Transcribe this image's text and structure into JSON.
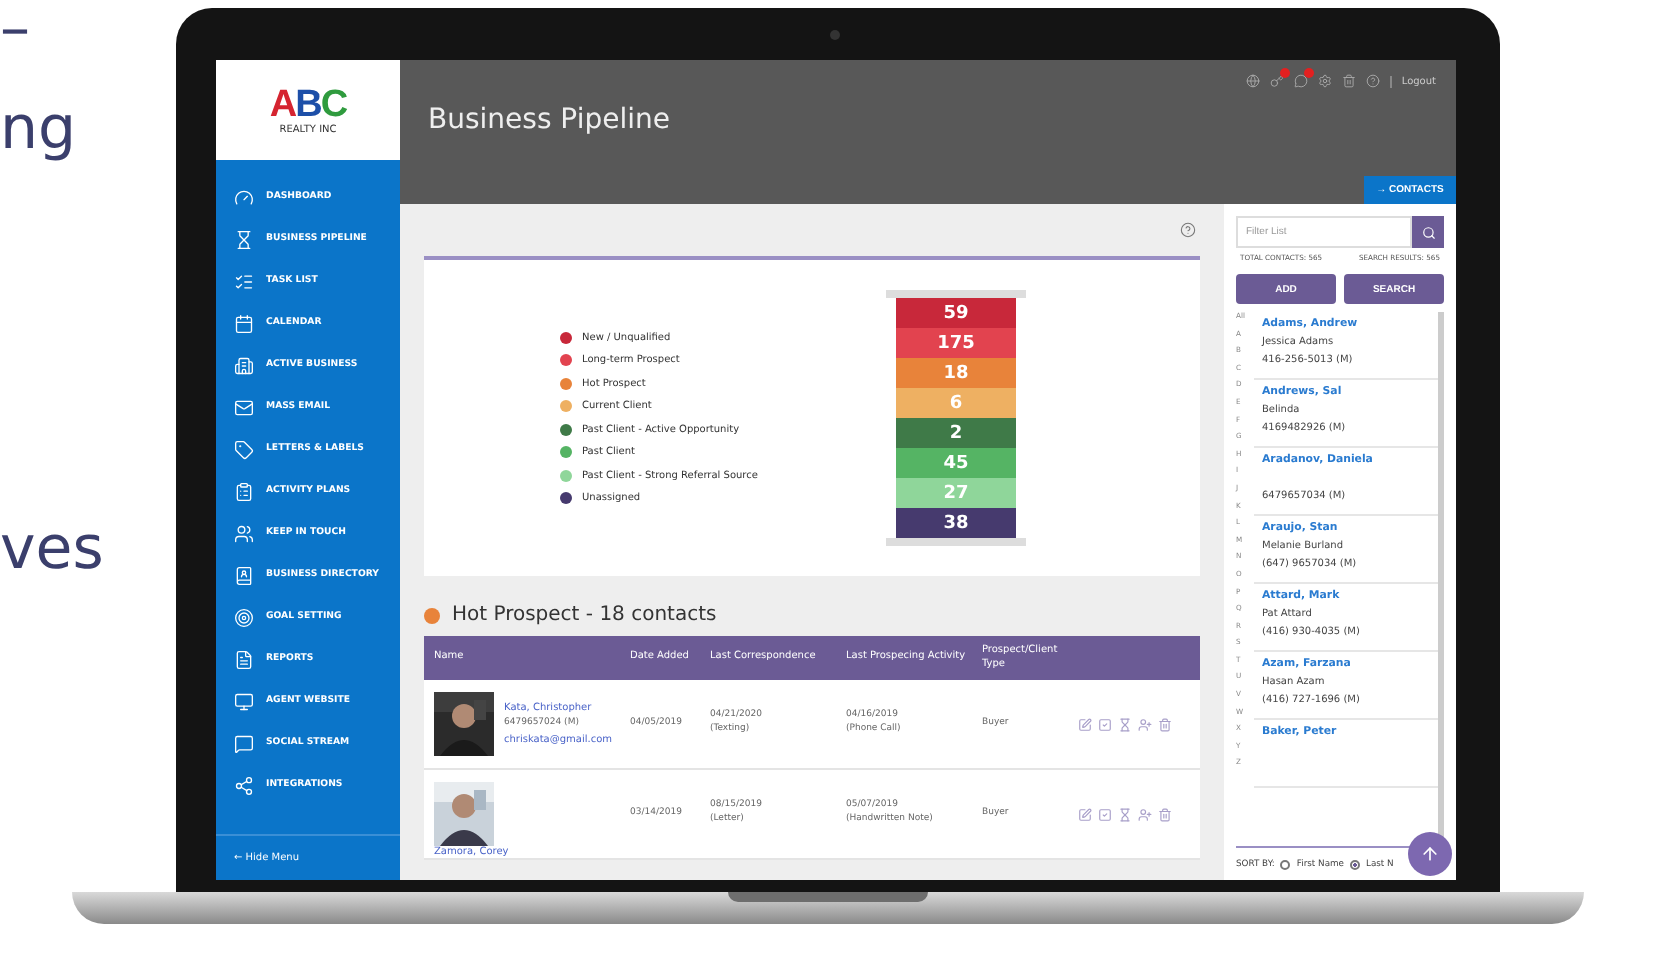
{
  "side_text": [
    "–",
    "ng",
    "ves"
  ],
  "logo": {
    "mark": "ABC",
    "subtitle": "REALTY INC"
  },
  "sidebar": {
    "items": [
      {
        "label": "DASHBOARD"
      },
      {
        "label": "BUSINESS PIPELINE"
      },
      {
        "label": "TASK LIST"
      },
      {
        "label": "CALENDAR"
      },
      {
        "label": "ACTIVE BUSINESS"
      },
      {
        "label": "MASS EMAIL"
      },
      {
        "label": "LETTERS & LABELS"
      },
      {
        "label": "ACTIVITY PLANS"
      },
      {
        "label": "KEEP IN TOUCH"
      },
      {
        "label": "BUSINESS DIRECTORY"
      },
      {
        "label": "GOAL SETTING"
      },
      {
        "label": "REPORTS"
      },
      {
        "label": "AGENT WEBSITE"
      },
      {
        "label": "SOCIAL STREAM"
      },
      {
        "label": "INTEGRATIONS"
      }
    ],
    "hide_menu": "← Hide Menu"
  },
  "header": {
    "title": "Business Pipeline",
    "icons": [
      {
        "badge": false
      },
      {
        "badge": true
      },
      {
        "badge": true
      },
      {
        "badge": false
      },
      {
        "badge": false
      },
      {
        "badge": false
      }
    ],
    "logout": "Logout",
    "contacts_button": "→ CONTACTS"
  },
  "pipeline": {
    "stages": [
      {
        "label": "New / Unqualified",
        "count": "59",
        "color": "#c8283a"
      },
      {
        "label": "Long-term Prospect",
        "count": "175",
        "color": "#e2434f"
      },
      {
        "label": "Hot Prospect",
        "count": "18",
        "color": "#e8833a"
      },
      {
        "label": "Current Client",
        "count": "6",
        "color": "#eeb062"
      },
      {
        "label": "Past Client - Active Opportunity",
        "count": "2",
        "color": "#3f7a48"
      },
      {
        "label": "Past Client",
        "count": "45",
        "color": "#55b464"
      },
      {
        "label": "Past Client - Strong Referral Source",
        "count": "27",
        "color": "#8fd69a"
      },
      {
        "label": "Unassigned",
        "count": "38",
        "color": "#463a6e"
      }
    ]
  },
  "contacts_section": {
    "title": "Hot Prospect - 18 contacts",
    "color": "#e8833a",
    "columns": [
      "Name",
      "Date Added",
      "Last Correspondence",
      "Last Prospecing Activity",
      "Prospect/Client Type"
    ],
    "rows": [
      {
        "name": "Kata, Christopher",
        "phone": "6479657024 (M)",
        "email": "chriskata@gmail.com",
        "date_added": "04/05/2019",
        "correspondence": "04/21/2020",
        "correspondence_type": "(Texting)",
        "activity": "04/16/2019",
        "activity_type": "(Phone Call)",
        "type": "Buyer"
      },
      {
        "name": "Zamora, Corey",
        "date_added": "03/14/2019",
        "correspondence": "08/15/2019",
        "correspondence_type": "(Letter)",
        "activity": "05/07/2019",
        "activity_type": "(Handwritten Note)",
        "type": "Buyer"
      }
    ]
  },
  "contacts_panel": {
    "filter_placeholder": "Filter List",
    "total": "TOTAL CONTACTS: 565",
    "results": "SEARCH RESULTS: 565",
    "buttons": [
      "ADD",
      "SEARCH"
    ],
    "letters": [
      "All",
      "A",
      "B",
      "C",
      "D",
      "E",
      "F",
      "G",
      "H",
      "I",
      "J",
      "K",
      "L",
      "M",
      "N",
      "O",
      "P",
      "Q",
      "R",
      "S",
      "T",
      "U",
      "V",
      "W",
      "X",
      "Y",
      "Z"
    ],
    "contacts": [
      {
        "name": "Adams, Andrew",
        "partner": "Jessica Adams",
        "phone": "416-256-5013 (M)"
      },
      {
        "name": "Andrews, Sal",
        "partner": "Belinda",
        "phone": "4169482926 (M)"
      },
      {
        "name": "Aradanov, Daniela",
        "phone": "6479657034 (M)"
      },
      {
        "name": "Araujo, Stan",
        "partner": "Melanie Burland",
        "phone": "(647) 9657034 (M)"
      },
      {
        "name": "Attard, Mark",
        "partner": "Pat Attard",
        "phone": "(416) 930-4035 (M)"
      },
      {
        "name": "Azam, Farzana",
        "partner": "Hasan Azam",
        "phone": "(416) 727-1696 (M)"
      },
      {
        "name": "Baker, Peter"
      }
    ],
    "sort_label": "SORT BY:",
    "sort_options": [
      {
        "label": "First Name",
        "selected": false
      },
      {
        "label": "Last N",
        "selected": true
      }
    ]
  }
}
